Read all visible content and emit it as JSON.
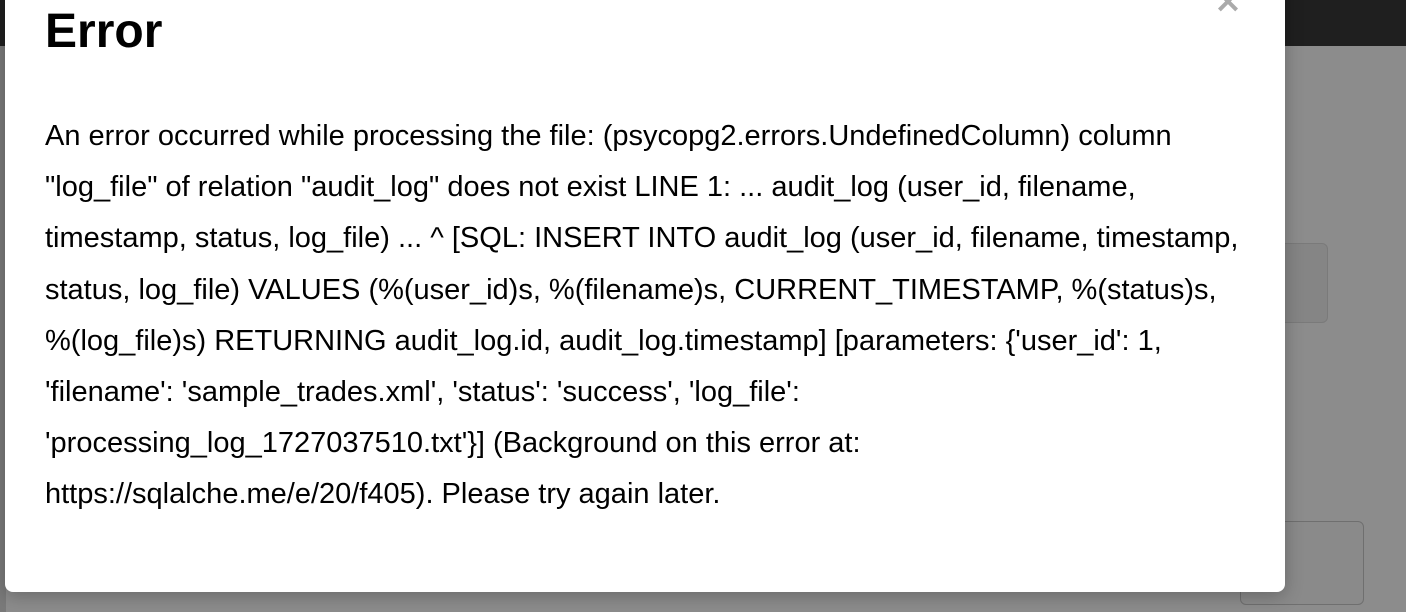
{
  "modal": {
    "title": "Error",
    "close_label": "×",
    "message": "An error occurred while processing the file: (psycopg2.errors.UndefinedColumn) column \"log_file\" of relation \"audit_log\" does not exist LINE 1: ... audit_log (user_id, filename, timestamp, status, log_file) ... ^ [SQL: INSERT INTO audit_log (user_id, filename, timestamp, status, log_file) VALUES (%(user_id)s, %(filename)s, CURRENT_TIMESTAMP, %(status)s, %(log_file)s) RETURNING audit_log.id, audit_log.timestamp] [parameters: {'user_id': 1, 'filename': 'sample_trades.xml', 'status': 'success', 'log_file': 'processing_log_1727037510.txt'}] (Background on this error at: https://sqlalche.me/e/20/f405). Please try again later."
  },
  "colors": {
    "overlay": "#8c8c8c",
    "topbar": "#1f1f1f",
    "modal_background": "#ffffff",
    "close_icon": "#aaaaaa",
    "text": "#000000"
  },
  "icons": {
    "close": "close-icon"
  }
}
